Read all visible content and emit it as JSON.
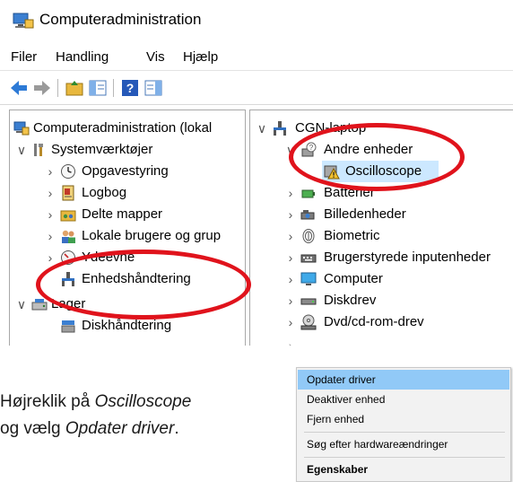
{
  "window": {
    "title": "Computeradministration"
  },
  "menu": [
    "Filer",
    "Handling",
    "Vis",
    "Hjælp"
  ],
  "left_tree": {
    "root": "Computeradministration (lokal",
    "systemtools": "Systemværktøjer",
    "task_scheduler": "Opgavestyring",
    "logbook": "Logbog",
    "shared_folders": "Delte mapper",
    "local_users": "Lokale brugere og grup",
    "performance": "Ydeevne",
    "device_manager": "Enhedshåndtering",
    "storage": "Lager",
    "disk_management": "Diskhåndtering"
  },
  "right_tree": {
    "computer_name": "CGN-laptop",
    "other_devices": "Andre enheder",
    "oscilloscope": "Oscilloscope",
    "batteries": "Batterier",
    "imaging": "Billedenheder",
    "biometric": "Biometric",
    "hid": "Brugerstyrede inputenheder",
    "computer": "Computer",
    "disk_drives": "Diskdrev",
    "dvd": "Dvd/cd-rom-drev"
  },
  "instruction": {
    "prefix": "Højreklik på ",
    "target": "Oscilloscope",
    "middle": "og vælg ",
    "action": "Opdater driver",
    "suffix": "."
  },
  "context_menu": {
    "update_driver": "Opdater driver",
    "disable": "Deaktiver enhed",
    "uninstall": "Fjern enhed",
    "scan": "Søg efter hardwareændringer",
    "properties": "Egenskaber"
  },
  "colors": {
    "annotation": "#e0131c",
    "selection": "#cce8ff",
    "menu_highlight": "#91c9f7"
  }
}
